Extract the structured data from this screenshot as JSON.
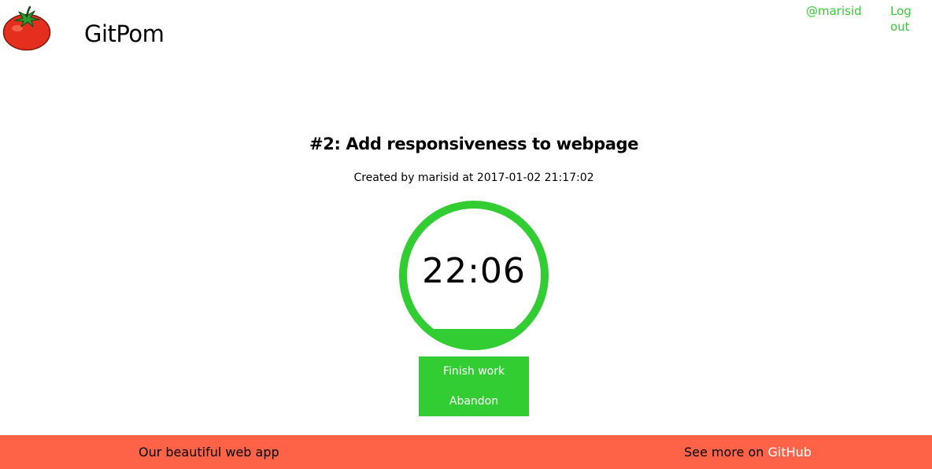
{
  "header": {
    "brand": "GitPom",
    "user_link": "@marisid",
    "logout_link": "Log out",
    "logo_icon": "tomato-icon"
  },
  "task": {
    "title": "#2: Add responsiveness to webpage",
    "meta": "Created by marisid at 2017-01-02 21:17:02"
  },
  "timer": {
    "display": "22:06",
    "ring_icon": "timer-progress-ring"
  },
  "actions": {
    "finish_label": "Finish work",
    "abandon_label": "Abandon"
  },
  "footer": {
    "tagline": "Our beautiful web app",
    "see_more_prefix": "See more on ",
    "github_link": "GitHub"
  },
  "colors": {
    "accent_green": "#32cd32",
    "footer_bg": "#ff6347",
    "tomato_red": "#e62e1e",
    "leaf_green": "#2e9a2e"
  }
}
